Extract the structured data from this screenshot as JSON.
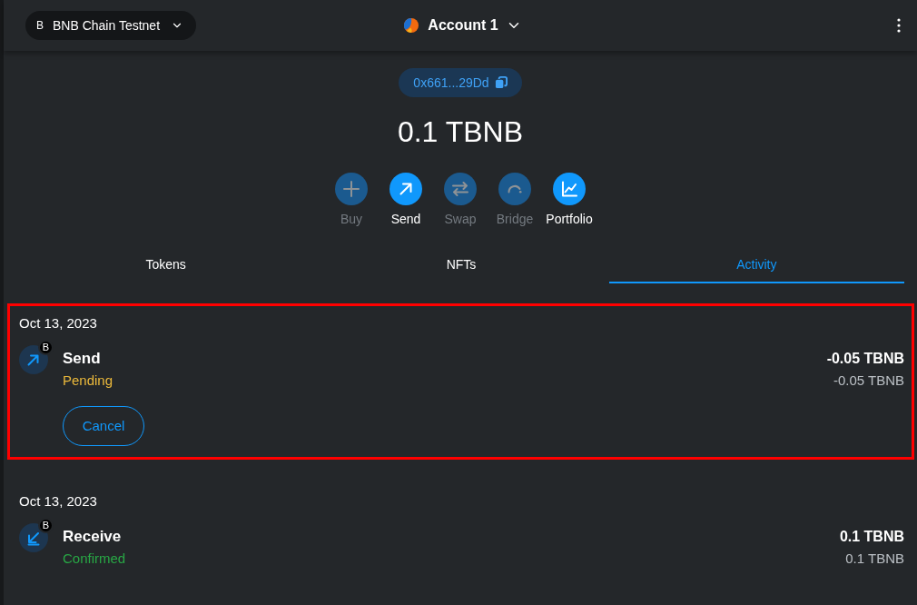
{
  "header": {
    "network": {
      "initial": "B",
      "name": "BNB Chain Testnet"
    },
    "account": {
      "name": "Account 1"
    }
  },
  "address": "0x661...29Dd",
  "balance": "0.1 TBNB",
  "actions": [
    {
      "kind": "buy",
      "label": "Buy",
      "disabled": true
    },
    {
      "kind": "send",
      "label": "Send",
      "disabled": false
    },
    {
      "kind": "swap",
      "label": "Swap",
      "disabled": true
    },
    {
      "kind": "bridge",
      "label": "Bridge",
      "disabled": true
    },
    {
      "kind": "portfolio",
      "label": "Portfolio",
      "disabled": false
    }
  ],
  "tabs": [
    {
      "label": "Tokens",
      "selected": false
    },
    {
      "label": "NFTs",
      "selected": false
    },
    {
      "label": "Activity",
      "selected": true
    }
  ],
  "activity": [
    {
      "date": "Oct 13, 2023",
      "highlighted": true,
      "transactions": [
        {
          "kind": "send",
          "badge": "B",
          "title": "Send",
          "status": "Pending",
          "color": "#ebb93b",
          "amount": "-0.05 TBNB",
          "secondary_amount": "-0.05 TBNB",
          "buttons": [
            "Cancel"
          ]
        }
      ]
    },
    {
      "date": "Oct 13, 2023",
      "highlighted": false,
      "transactions": [
        {
          "kind": "receive",
          "badge": "B",
          "title": "Receive",
          "status": "Confirmed",
          "color": "#28a745",
          "amount": "0.1 TBNB",
          "secondary_amount": "0.1 TBNB"
        }
      ]
    }
  ]
}
